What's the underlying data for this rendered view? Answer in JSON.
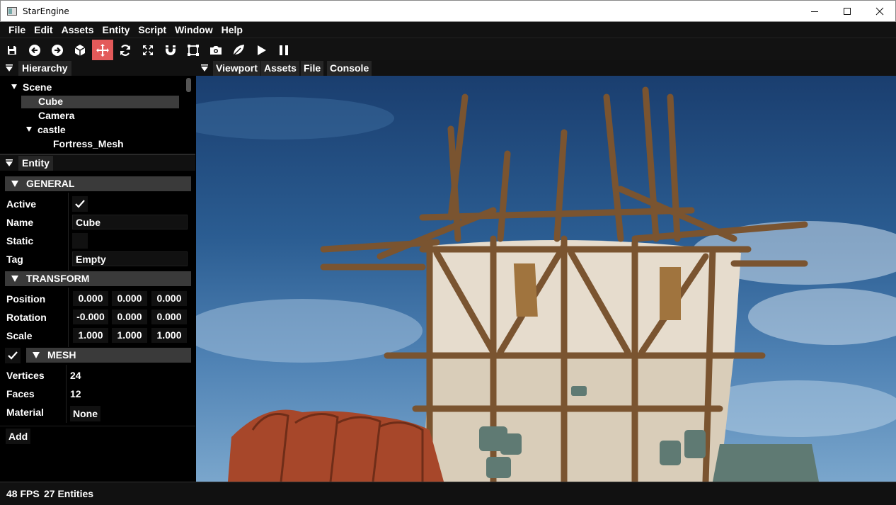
{
  "window": {
    "title": "StarEngine",
    "minimize": "minimize",
    "maximize": "maximize",
    "close": "close"
  },
  "menu": [
    "File",
    "Edit",
    "Assets",
    "Entity",
    "Script",
    "Window",
    "Help"
  ],
  "toolbar": {
    "icons": [
      "save-icon",
      "undo-icon",
      "redo-icon",
      "cube-icon",
      "move-icon",
      "rotate-icon",
      "scale-icon",
      "magnet-icon",
      "bounds-icon",
      "camera-icon",
      "leaf-icon",
      "play-icon",
      "pause-icon"
    ],
    "active": "move-icon",
    "accent": "#e35a5a"
  },
  "hierarchy": {
    "tab": "Hierarchy",
    "items": [
      {
        "label": "Scene",
        "expanded": true
      },
      {
        "label": "Cube",
        "selected": true
      },
      {
        "label": "Camera"
      },
      {
        "label": "castle",
        "expanded": true
      },
      {
        "label": "Fortress_Mesh"
      }
    ]
  },
  "entity": {
    "tab": "Entity",
    "general": {
      "title": "GENERAL",
      "active_label": "Active",
      "active": true,
      "name_label": "Name",
      "name": "Cube",
      "static_label": "Static",
      "static": false,
      "tag_label": "Tag",
      "tag": "Empty"
    },
    "transform": {
      "title": "TRANSFORM",
      "position_label": "Position",
      "position": [
        "0.000",
        "0.000",
        "0.000"
      ],
      "rotation_label": "Rotation",
      "rotation": [
        "-0.000",
        "0.000",
        "0.000"
      ],
      "scale_label": "Scale",
      "scale": [
        "1.000",
        "1.000",
        "1.000"
      ]
    },
    "mesh": {
      "title": "MESH",
      "enabled": true,
      "vertices_label": "Vertices",
      "vertices": "24",
      "faces_label": "Faces",
      "faces": "12",
      "material_label": "Material",
      "material": "None"
    },
    "add_label": "Add"
  },
  "tabs": [
    "Viewport",
    "Assets",
    "File",
    "Console"
  ],
  "status": {
    "fps": "48 FPS",
    "entities": "27 Entities"
  }
}
